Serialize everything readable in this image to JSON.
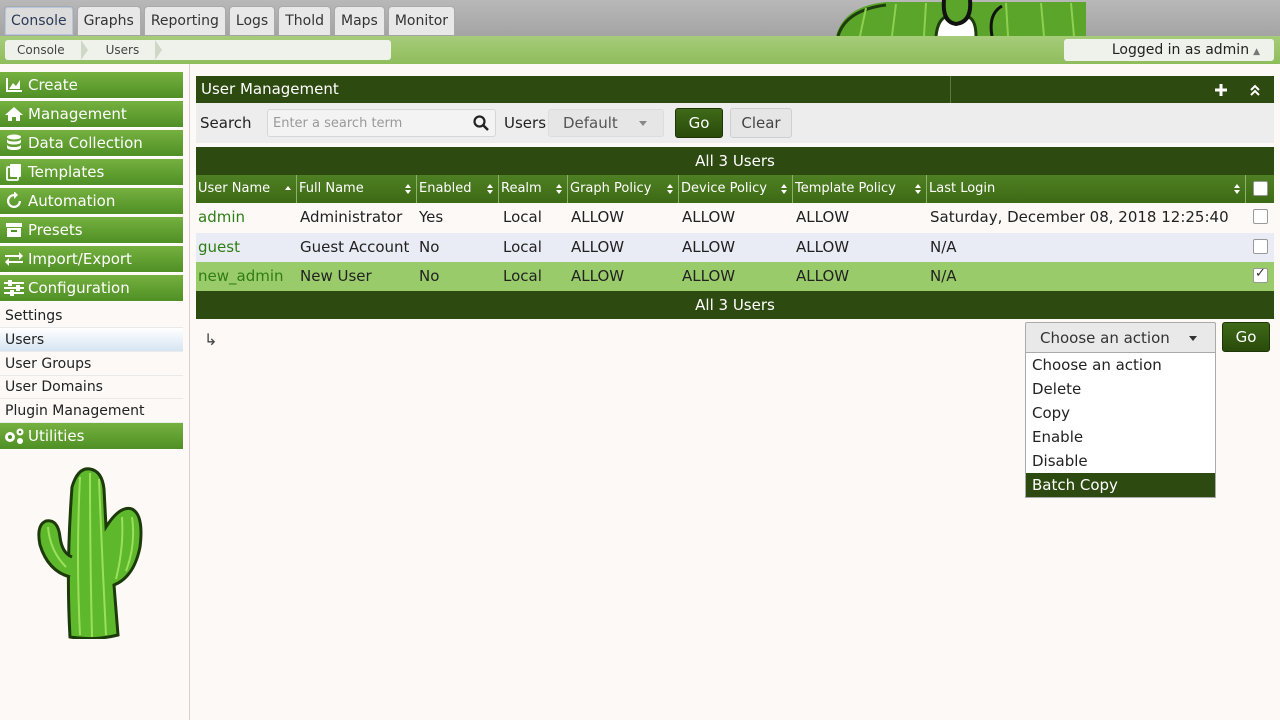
{
  "top_tabs": [
    "Console",
    "Graphs",
    "Reporting",
    "Logs",
    "Thold",
    "Maps",
    "Monitor"
  ],
  "breadcrumbs": [
    "Console",
    "Users"
  ],
  "login_status": "Logged in as admin",
  "sidebar": {
    "menus": [
      {
        "label": "Create",
        "icon": "chart-icon"
      },
      {
        "label": "Management",
        "icon": "home-icon"
      },
      {
        "label": "Data Collection",
        "icon": "database-icon"
      },
      {
        "label": "Templates",
        "icon": "templates-icon"
      },
      {
        "label": "Automation",
        "icon": "refresh-icon"
      },
      {
        "label": "Presets",
        "icon": "presets-icon"
      },
      {
        "label": "Import/Export",
        "icon": "exchange-icon"
      },
      {
        "label": "Configuration",
        "icon": "sliders-icon"
      }
    ],
    "config_items": [
      "Settings",
      "Users",
      "User Groups",
      "User Domains",
      "Plugin Management"
    ],
    "selected_item": "Users",
    "utilities": {
      "label": "Utilities",
      "icon": "gears-icon"
    }
  },
  "panel": {
    "title": "User Management",
    "search_label": "Search",
    "search_placeholder": "Enter a search term",
    "users_label": "Users",
    "users_filter_value": "Default",
    "go_label": "Go",
    "clear_label": "Clear"
  },
  "table": {
    "count_text": "All 3 Users",
    "columns": [
      "User Name",
      "Full Name",
      "Enabled",
      "Realm",
      "Graph Policy",
      "Device Policy",
      "Template Policy",
      "Last Login"
    ],
    "rows": [
      {
        "username": "admin",
        "fullname": "Administrator",
        "enabled": "Yes",
        "realm": "Local",
        "graph": "ALLOW",
        "device": "ALLOW",
        "template": "ALLOW",
        "last_login": "Saturday, December 08, 2018 12:25:40",
        "checked": false
      },
      {
        "username": "guest",
        "fullname": "Guest Account",
        "enabled": "No",
        "realm": "Local",
        "graph": "ALLOW",
        "device": "ALLOW",
        "template": "ALLOW",
        "last_login": "N/A",
        "checked": false
      },
      {
        "username": "new_admin",
        "fullname": "New User",
        "enabled": "No",
        "realm": "Local",
        "graph": "ALLOW",
        "device": "ALLOW",
        "template": "ALLOW",
        "last_login": "N/A",
        "checked": true
      }
    ]
  },
  "actions": {
    "selected": "Choose an action",
    "options": [
      "Choose an action",
      "Delete",
      "Copy",
      "Enable",
      "Disable",
      "Batch Copy"
    ],
    "highlighted": "Batch Copy",
    "go_label": "Go"
  },
  "colors": {
    "brand_green": "#2d4a10",
    "menu_green": "#5f9e2f",
    "link_green": "#2e7d14",
    "selected_row": "#9acb6a"
  }
}
